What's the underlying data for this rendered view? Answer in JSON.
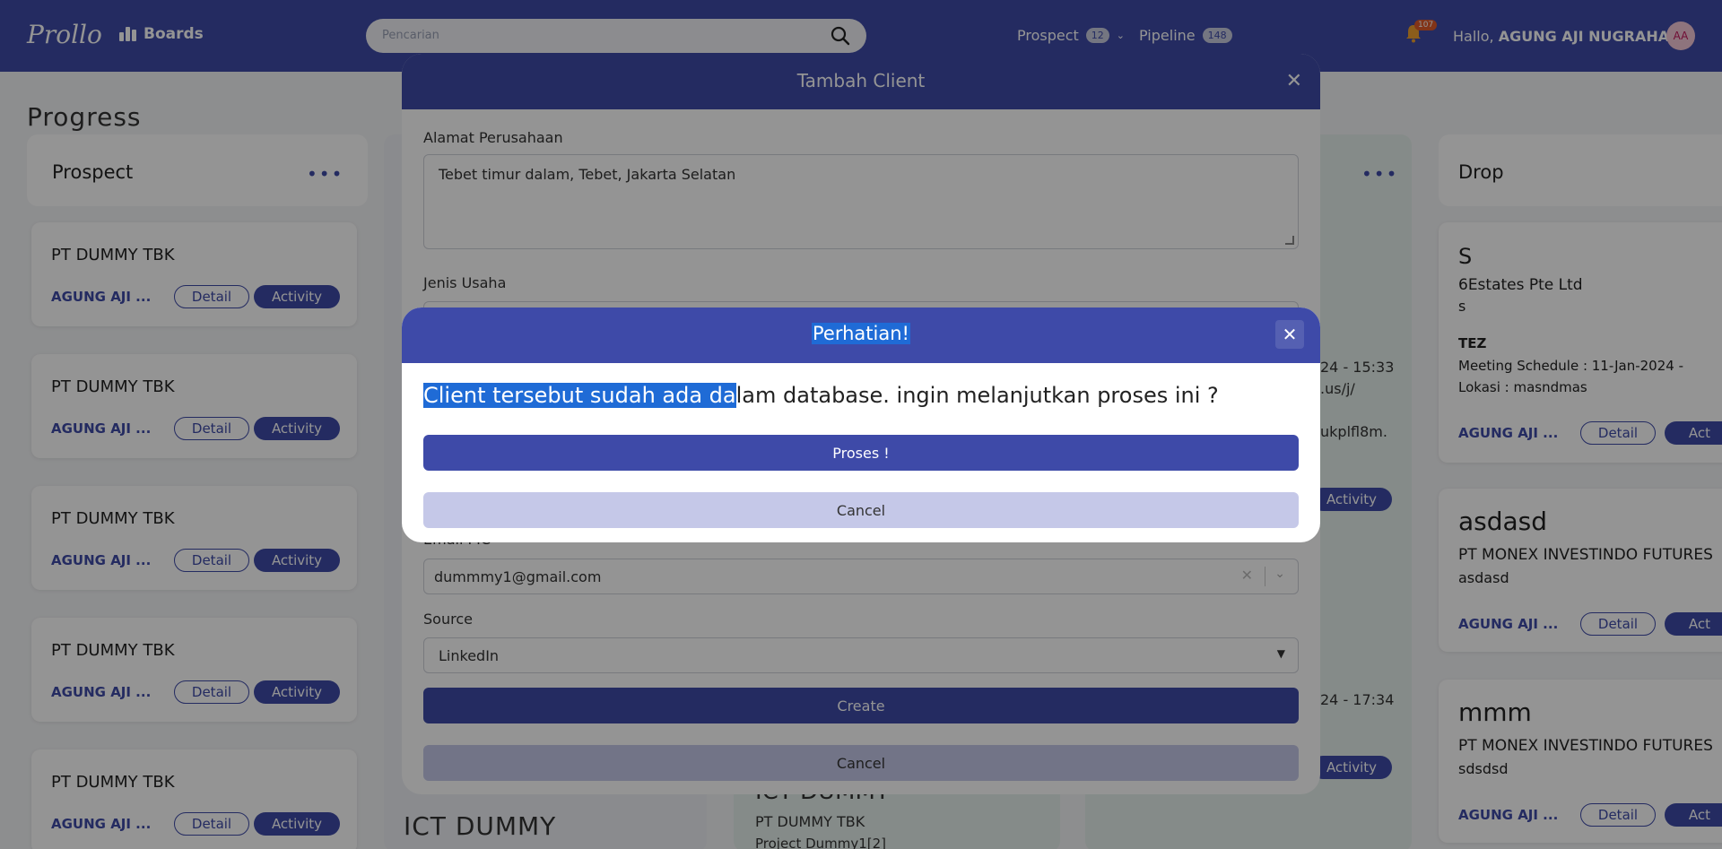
{
  "nav": {
    "logo": "Prollo",
    "boards_label": "Boards",
    "search_placeholder": "Pencarian",
    "prospect_label": "Prospect",
    "prospect_count": "12",
    "pipeline_label": "Pipeline",
    "pipeline_count": "148",
    "bell_badge": "107",
    "hello_prefix": "Hallo,",
    "user_name": "AGUNG AJI NUGRAHA",
    "avatar_initials": "AA"
  },
  "board": {
    "page_title": "Progress",
    "prospect_col": {
      "title": "Prospect",
      "cards": [
        {
          "title": "PT DUMMY TBK",
          "user": "AGUNG AJI ...",
          "detail": "Detail",
          "activity": "Activity"
        },
        {
          "title": "PT DUMMY TBK",
          "user": "AGUNG AJI ...",
          "detail": "Detail",
          "activity": "Activity"
        },
        {
          "title": "PT DUMMY TBK",
          "user": "AGUNG AJI ...",
          "detail": "Detail",
          "activity": "Activity"
        },
        {
          "title": "PT DUMMY TBK",
          "user": "AGUNG AJI ...",
          "detail": "Detail",
          "activity": "Activity"
        },
        {
          "title": "PT DUMMY TBK",
          "user": "AGUNG AJI ...",
          "detail": "Detail",
          "activity": "Activity"
        }
      ]
    },
    "second_col": {
      "bottom_title": "ICT DUMMY"
    },
    "third_col": {
      "ghost_title": "ICT DUMMY",
      "card_company": "PT DUMMY TBK",
      "card_project": "Project Dummy1[2]"
    },
    "fourth_col": {
      "text1": "24 - 15:33",
      "text2": ".us/j/",
      "text3": "ukplfl8m.",
      "activity1": "Activity",
      "text4": "24 - 17:34",
      "activity2": "Activity"
    },
    "drop_col": {
      "title": "Drop",
      "cards": [
        {
          "name": "S",
          "company": "6Estates Pte Ltd",
          "sub": "s",
          "tag": "TEZ",
          "meeting": "Meeting Schedule : 11-Jan-2024 -",
          "lokasi": "Lokasi : masndmas",
          "user": "AGUNG AJI ...",
          "detail": "Detail",
          "activity": "Act"
        },
        {
          "name": "asdasd",
          "company": "PT MONEX INVESTINDO FUTURES",
          "sub": "asdasd",
          "user": "AGUNG AJI ...",
          "detail": "Detail",
          "activity": "Act"
        },
        {
          "name": "mmm",
          "company": "PT MONEX INVESTINDO FUTURES",
          "sub": "sdsdsd",
          "user": "AGUNG AJI ...",
          "detail": "Detail",
          "activity": "Act"
        }
      ]
    }
  },
  "modal": {
    "title": "Tambah Client",
    "alamat_label": "Alamat Perusahaan",
    "alamat_value": "Tebet timur dalam, Tebet, Jakarta Selatan",
    "jenis_label": "Jenis Usaha",
    "email_label": "Email PIC",
    "email_value": "dummmy1@gmail.com",
    "source_label": "Source",
    "source_value": "LinkedIn",
    "create_label": "Create",
    "cancel_label": "Cancel"
  },
  "alert": {
    "title": "Perhatian!",
    "message_highlight": "Client tersebut sudah ada da",
    "message_rest": "lam database. ingin melanjutkan proses ini ?",
    "proses_label": "Proses !",
    "cancel_label": "Cancel"
  },
  "colors": {
    "brand": "#3e4aa8",
    "cancel_bg": "#c5c8e8"
  }
}
